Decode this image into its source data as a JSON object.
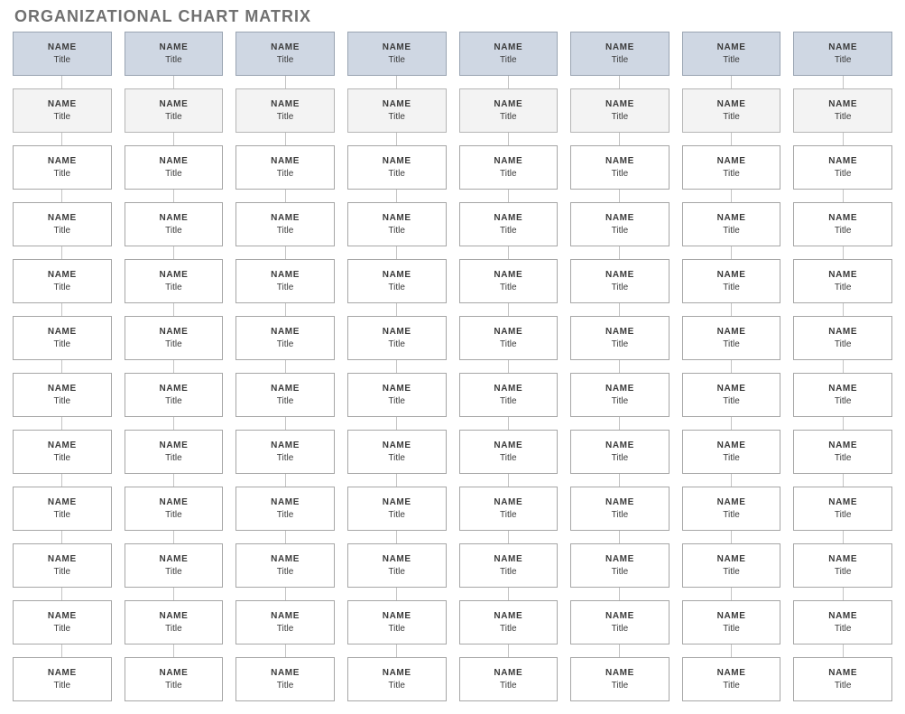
{
  "page_title": "ORGANIZATIONAL CHART MATRIX",
  "columns": [
    {
      "cells": [
        {
          "name": "NAME",
          "title": "Title",
          "style": "header"
        },
        {
          "name": "NAME",
          "title": "Title",
          "style": "sub"
        },
        {
          "name": "NAME",
          "title": "Title",
          "style": "plain"
        },
        {
          "name": "NAME",
          "title": "Title",
          "style": "plain"
        },
        {
          "name": "NAME",
          "title": "Title",
          "style": "plain"
        },
        {
          "name": "NAME",
          "title": "Title",
          "style": "plain"
        },
        {
          "name": "NAME",
          "title": "Title",
          "style": "plain"
        },
        {
          "name": "NAME",
          "title": "Title",
          "style": "plain"
        },
        {
          "name": "NAME",
          "title": "Title",
          "style": "plain"
        },
        {
          "name": "NAME",
          "title": "Title",
          "style": "plain"
        },
        {
          "name": "NAME",
          "title": "Title",
          "style": "plain"
        },
        {
          "name": "NAME",
          "title": "Title",
          "style": "plain"
        }
      ]
    },
    {
      "cells": [
        {
          "name": "NAME",
          "title": "Title",
          "style": "header"
        },
        {
          "name": "NAME",
          "title": "Title",
          "style": "sub"
        },
        {
          "name": "NAME",
          "title": "Title",
          "style": "plain"
        },
        {
          "name": "NAME",
          "title": "Title",
          "style": "plain"
        },
        {
          "name": "NAME",
          "title": "Title",
          "style": "plain"
        },
        {
          "name": "NAME",
          "title": "Title",
          "style": "plain"
        },
        {
          "name": "NAME",
          "title": "Title",
          "style": "plain"
        },
        {
          "name": "NAME",
          "title": "Title",
          "style": "plain"
        },
        {
          "name": "NAME",
          "title": "Title",
          "style": "plain"
        },
        {
          "name": "NAME",
          "title": "Title",
          "style": "plain"
        },
        {
          "name": "NAME",
          "title": "Title",
          "style": "plain"
        },
        {
          "name": "NAME",
          "title": "Title",
          "style": "plain"
        }
      ]
    },
    {
      "cells": [
        {
          "name": "NAME",
          "title": "Title",
          "style": "header"
        },
        {
          "name": "NAME",
          "title": "Title",
          "style": "sub"
        },
        {
          "name": "NAME",
          "title": "Title",
          "style": "plain"
        },
        {
          "name": "NAME",
          "title": "Title",
          "style": "plain"
        },
        {
          "name": "NAME",
          "title": "Title",
          "style": "plain"
        },
        {
          "name": "NAME",
          "title": "Title",
          "style": "plain"
        },
        {
          "name": "NAME",
          "title": "Title",
          "style": "plain"
        },
        {
          "name": "NAME",
          "title": "Title",
          "style": "plain"
        },
        {
          "name": "NAME",
          "title": "Title",
          "style": "plain"
        },
        {
          "name": "NAME",
          "title": "Title",
          "style": "plain"
        },
        {
          "name": "NAME",
          "title": "Title",
          "style": "plain"
        },
        {
          "name": "NAME",
          "title": "Title",
          "style": "plain"
        }
      ]
    },
    {
      "cells": [
        {
          "name": "NAME",
          "title": "Title",
          "style": "header"
        },
        {
          "name": "NAME",
          "title": "Title",
          "style": "sub"
        },
        {
          "name": "NAME",
          "title": "Title",
          "style": "plain"
        },
        {
          "name": "NAME",
          "title": "Title",
          "style": "plain"
        },
        {
          "name": "NAME",
          "title": "Title",
          "style": "plain"
        },
        {
          "name": "NAME",
          "title": "Title",
          "style": "plain"
        },
        {
          "name": "NAME",
          "title": "Title",
          "style": "plain"
        },
        {
          "name": "NAME",
          "title": "Title",
          "style": "plain"
        },
        {
          "name": "NAME",
          "title": "Title",
          "style": "plain"
        },
        {
          "name": "NAME",
          "title": "Title",
          "style": "plain"
        },
        {
          "name": "NAME",
          "title": "Title",
          "style": "plain"
        },
        {
          "name": "NAME",
          "title": "Title",
          "style": "plain"
        }
      ]
    },
    {
      "cells": [
        {
          "name": "NAME",
          "title": "Title",
          "style": "header"
        },
        {
          "name": "NAME",
          "title": "Title",
          "style": "sub"
        },
        {
          "name": "NAME",
          "title": "Title",
          "style": "plain"
        },
        {
          "name": "NAME",
          "title": "Title",
          "style": "plain"
        },
        {
          "name": "NAME",
          "title": "Title",
          "style": "plain"
        },
        {
          "name": "NAME",
          "title": "Title",
          "style": "plain"
        },
        {
          "name": "NAME",
          "title": "Title",
          "style": "plain"
        },
        {
          "name": "NAME",
          "title": "Title",
          "style": "plain"
        },
        {
          "name": "NAME",
          "title": "Title",
          "style": "plain"
        },
        {
          "name": "NAME",
          "title": "Title",
          "style": "plain"
        },
        {
          "name": "NAME",
          "title": "Title",
          "style": "plain"
        },
        {
          "name": "NAME",
          "title": "Title",
          "style": "plain"
        }
      ]
    },
    {
      "cells": [
        {
          "name": "NAME",
          "title": "Title",
          "style": "header"
        },
        {
          "name": "NAME",
          "title": "Title",
          "style": "sub"
        },
        {
          "name": "NAME",
          "title": "Title",
          "style": "plain"
        },
        {
          "name": "NAME",
          "title": "Title",
          "style": "plain"
        },
        {
          "name": "NAME",
          "title": "Title",
          "style": "plain"
        },
        {
          "name": "NAME",
          "title": "Title",
          "style": "plain"
        },
        {
          "name": "NAME",
          "title": "Title",
          "style": "plain"
        },
        {
          "name": "NAME",
          "title": "Title",
          "style": "plain"
        },
        {
          "name": "NAME",
          "title": "Title",
          "style": "plain"
        },
        {
          "name": "NAME",
          "title": "Title",
          "style": "plain"
        },
        {
          "name": "NAME",
          "title": "Title",
          "style": "plain"
        },
        {
          "name": "NAME",
          "title": "Title",
          "style": "plain"
        }
      ]
    },
    {
      "cells": [
        {
          "name": "NAME",
          "title": "Title",
          "style": "header"
        },
        {
          "name": "NAME",
          "title": "Title",
          "style": "sub"
        },
        {
          "name": "NAME",
          "title": "Title",
          "style": "plain"
        },
        {
          "name": "NAME",
          "title": "Title",
          "style": "plain"
        },
        {
          "name": "NAME",
          "title": "Title",
          "style": "plain"
        },
        {
          "name": "NAME",
          "title": "Title",
          "style": "plain"
        },
        {
          "name": "NAME",
          "title": "Title",
          "style": "plain"
        },
        {
          "name": "NAME",
          "title": "Title",
          "style": "plain"
        },
        {
          "name": "NAME",
          "title": "Title",
          "style": "plain"
        },
        {
          "name": "NAME",
          "title": "Title",
          "style": "plain"
        },
        {
          "name": "NAME",
          "title": "Title",
          "style": "plain"
        },
        {
          "name": "NAME",
          "title": "Title",
          "style": "plain"
        }
      ]
    },
    {
      "cells": [
        {
          "name": "NAME",
          "title": "Title",
          "style": "header"
        },
        {
          "name": "NAME",
          "title": "Title",
          "style": "sub"
        },
        {
          "name": "NAME",
          "title": "Title",
          "style": "plain"
        },
        {
          "name": "NAME",
          "title": "Title",
          "style": "plain"
        },
        {
          "name": "NAME",
          "title": "Title",
          "style": "plain"
        },
        {
          "name": "NAME",
          "title": "Title",
          "style": "plain"
        },
        {
          "name": "NAME",
          "title": "Title",
          "style": "plain"
        },
        {
          "name": "NAME",
          "title": "Title",
          "style": "plain"
        },
        {
          "name": "NAME",
          "title": "Title",
          "style": "plain"
        },
        {
          "name": "NAME",
          "title": "Title",
          "style": "plain"
        },
        {
          "name": "NAME",
          "title": "Title",
          "style": "plain"
        },
        {
          "name": "NAME",
          "title": "Title",
          "style": "plain"
        }
      ]
    }
  ]
}
